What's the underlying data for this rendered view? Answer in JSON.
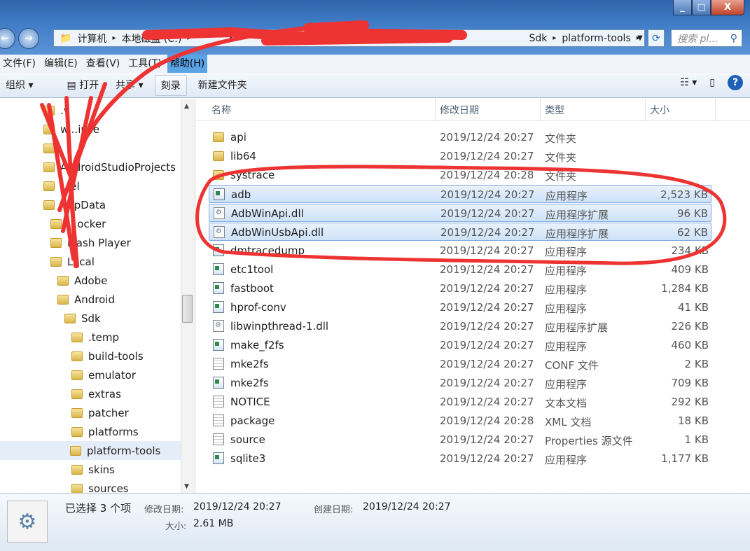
{
  "window": {
    "min": "_",
    "max": "□",
    "close": "X"
  },
  "address": {
    "segments": [
      "计算机",
      "本地磁盘 (C:)",
      "",
      "",
      "",
      "Sdk",
      "platform-tools"
    ],
    "search_placeholder": "搜索 pl..."
  },
  "menu": [
    "文件(F)",
    "编辑(E)",
    "查看(V)",
    "工具(T)",
    "帮助(H)"
  ],
  "toolbar": {
    "organize": "组织 ▾",
    "open": "打开",
    "share": "共享 ▾",
    "burn": "刻录",
    "new_folder": "新建文件夹"
  },
  "nav": [
    {
      "label": ".v",
      "indent": 0
    },
    {
      "label": "w...ipse",
      "indent": 0
    },
    {
      "label": "",
      "indent": 0
    },
    {
      "label": "AndroidStudioProjects",
      "indent": 0
    },
    {
      "label": "...el",
      "indent": 0
    },
    {
      "label": "AppData",
      "indent": 0
    },
    {
      "label": "...ocker",
      "indent": 1
    },
    {
      "label": "Flash Player",
      "indent": 1
    },
    {
      "label": "Local",
      "indent": 1
    },
    {
      "label": "Adobe",
      "indent": 2
    },
    {
      "label": "Android",
      "indent": 2
    },
    {
      "label": "Sdk",
      "indent": 3
    },
    {
      "label": ".temp",
      "indent": 4
    },
    {
      "label": "build-tools",
      "indent": 4
    },
    {
      "label": "emulator",
      "indent": 4
    },
    {
      "label": "extras",
      "indent": 4
    },
    {
      "label": "patcher",
      "indent": 4
    },
    {
      "label": "platforms",
      "indent": 4
    },
    {
      "label": "platform-tools",
      "indent": 4,
      "selected": true
    },
    {
      "label": "skins",
      "indent": 4
    },
    {
      "label": "sources",
      "indent": 4
    }
  ],
  "columns": {
    "name": "名称",
    "date": "修改日期",
    "type": "类型",
    "size": "大小"
  },
  "files": [
    {
      "name": "api",
      "date": "2019/12/24 20:27",
      "type": "文件夹",
      "size": "",
      "icon": "folder"
    },
    {
      "name": "lib64",
      "date": "2019/12/24 20:27",
      "type": "文件夹",
      "size": "",
      "icon": "folder"
    },
    {
      "name": "systrace",
      "date": "2019/12/24 20:28",
      "type": "文件夹",
      "size": "",
      "icon": "folder"
    },
    {
      "name": "adb",
      "date": "2019/12/24 20:27",
      "type": "应用程序",
      "size": "2,523 KB",
      "icon": "exe",
      "selected": true
    },
    {
      "name": "AdbWinApi.dll",
      "date": "2019/12/24 20:27",
      "type": "应用程序扩展",
      "size": "96 KB",
      "icon": "dll",
      "selected": true
    },
    {
      "name": "AdbWinUsbApi.dll",
      "date": "2019/12/24 20:27",
      "type": "应用程序扩展",
      "size": "62 KB",
      "icon": "dll",
      "selected": true
    },
    {
      "name": "dmtracedump",
      "date": "2019/12/24 20:27",
      "type": "应用程序",
      "size": "234 KB",
      "icon": "exe"
    },
    {
      "name": "etc1tool",
      "date": "2019/12/24 20:27",
      "type": "应用程序",
      "size": "409 KB",
      "icon": "exe"
    },
    {
      "name": "fastboot",
      "date": "2019/12/24 20:27",
      "type": "应用程序",
      "size": "1,284 KB",
      "icon": "exe"
    },
    {
      "name": "hprof-conv",
      "date": "2019/12/24 20:27",
      "type": "应用程序",
      "size": "41 KB",
      "icon": "exe"
    },
    {
      "name": "libwinpthread-1.dll",
      "date": "2019/12/24 20:27",
      "type": "应用程序扩展",
      "size": "226 KB",
      "icon": "dll"
    },
    {
      "name": "make_f2fs",
      "date": "2019/12/24 20:27",
      "type": "应用程序",
      "size": "460 KB",
      "icon": "exe"
    },
    {
      "name": "mke2fs",
      "date": "2019/12/24 20:27",
      "type": "CONF 文件",
      "size": "2 KB",
      "icon": "doc"
    },
    {
      "name": "mke2fs",
      "date": "2019/12/24 20:27",
      "type": "应用程序",
      "size": "709 KB",
      "icon": "exe"
    },
    {
      "name": "NOTICE",
      "date": "2019/12/24 20:27",
      "type": "文本文档",
      "size": "292 KB",
      "icon": "doc"
    },
    {
      "name": "package",
      "date": "2019/12/24 20:28",
      "type": "XML 文档",
      "size": "18 KB",
      "icon": "doc"
    },
    {
      "name": "source",
      "date": "2019/12/24 20:27",
      "type": "Properties 源文件",
      "size": "1 KB",
      "icon": "doc"
    },
    {
      "name": "sqlite3",
      "date": "2019/12/24 20:27",
      "type": "应用程序",
      "size": "1,177 KB",
      "icon": "exe"
    }
  ],
  "status": {
    "selected": "已选择 3 个项",
    "modified_label": "修改日期:",
    "modified": "2019/12/24 20:27",
    "created_label": "创建日期:",
    "created": "2019/12/24 20:27",
    "size_label": "大小:",
    "size": "2.61 MB"
  },
  "annotation_color": "#ee3333"
}
